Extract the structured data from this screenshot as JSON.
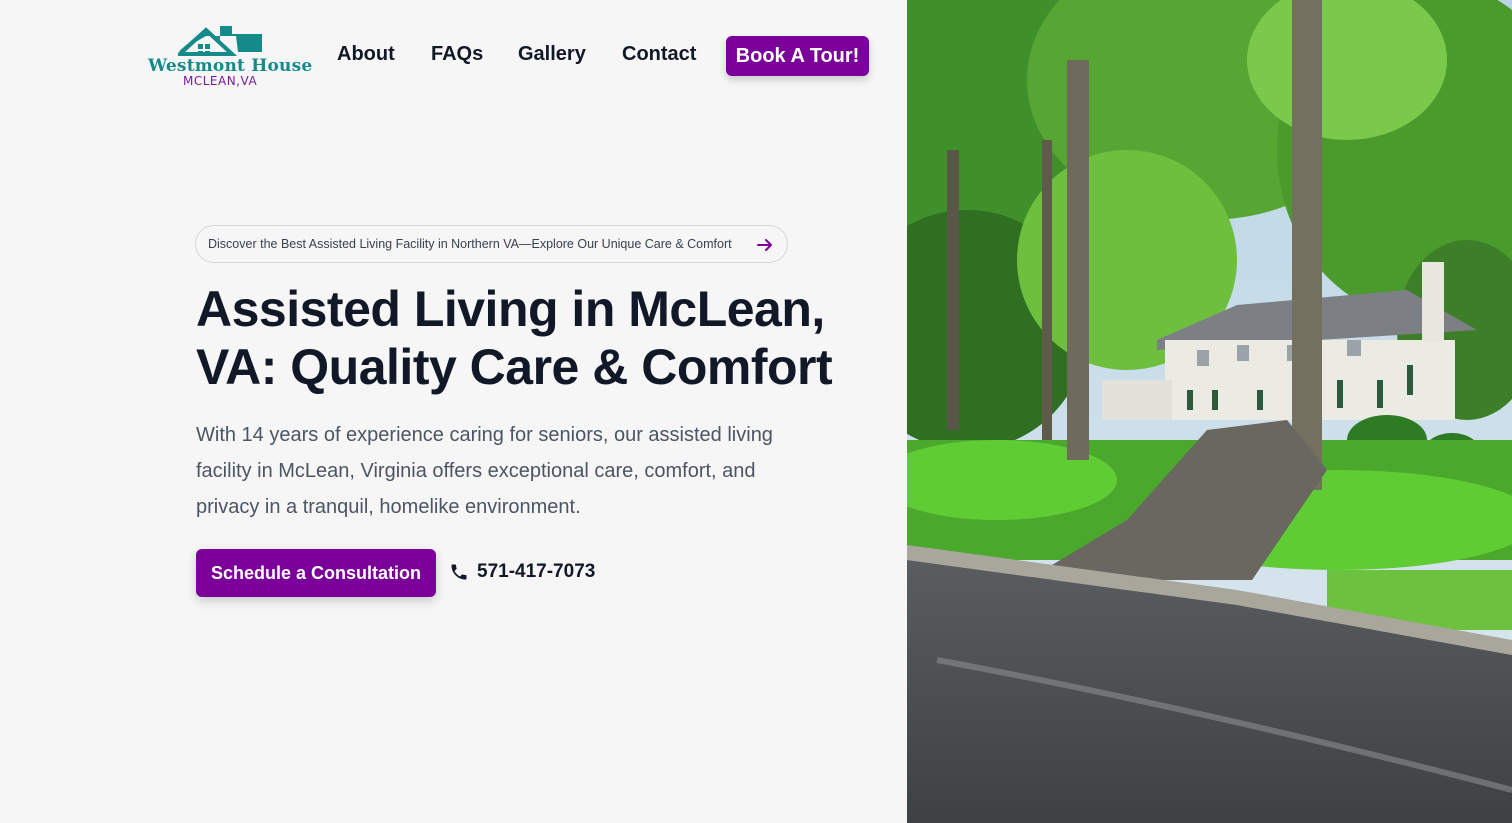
{
  "header": {
    "logo": {
      "name": "Westmont House",
      "subtitle": "MCLEAN,VA",
      "icon": "house-icon"
    },
    "nav": [
      {
        "label": "About"
      },
      {
        "label": "FAQs"
      },
      {
        "label": "Gallery"
      },
      {
        "label": "Contact"
      }
    ],
    "cta_label": "Book A Tour!"
  },
  "hero": {
    "announcement": "Discover the Best Assisted Living Facility in Northern VA—Explore Our Unique Care & Comfort",
    "announcement_icon": "arrow-right-icon",
    "title_line1": "Assisted Living in McLean,",
    "title_line2": "VA: Quality Care & Comfort",
    "description_line1": "With 14 years of experience caring for seniors, our assisted living",
    "description_line2": "facility in McLean, Virginia offers exceptional care, comfort, and",
    "description_line3": "privacy in a tranquil, homelike environment.",
    "cta_label": "Schedule a Consultation",
    "phone": "571-417-7073",
    "phone_icon": "phone-icon"
  },
  "image": {
    "subject": "house-photo"
  },
  "colors": {
    "brand_purple": "#7a0099",
    "brand_teal": "#148a8a",
    "text_dark": "#111827",
    "text_muted": "#4b5563",
    "background": "#f6f6f6"
  }
}
